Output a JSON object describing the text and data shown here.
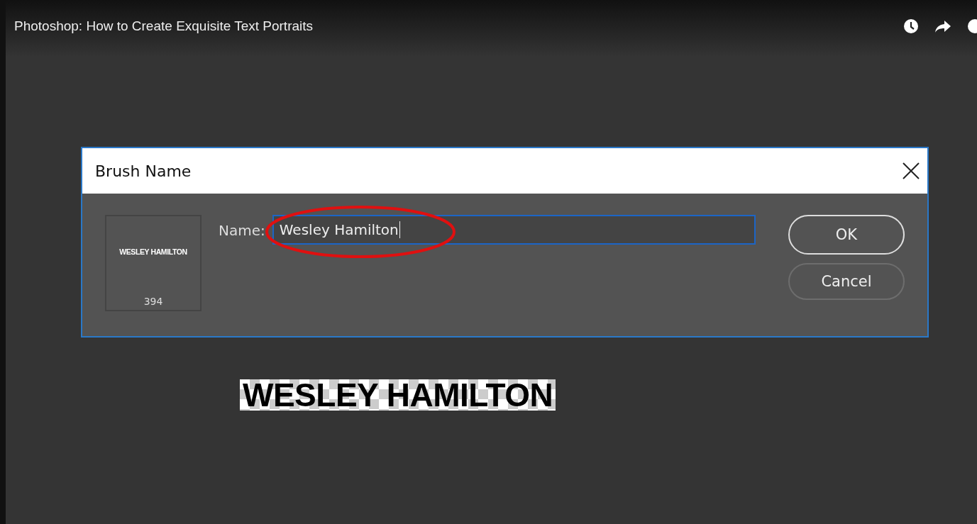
{
  "video": {
    "title": "Photoshop: How to Create Exquisite Text Portraits"
  },
  "dialog": {
    "title": "Brush Name",
    "preview": {
      "label": "WESLEY HAMILTON",
      "size": "394"
    },
    "name_field": {
      "label": "Name:",
      "value": "Wesley Hamilton"
    },
    "buttons": [
      {
        "label": "OK",
        "kind": "primary"
      },
      {
        "label": "Cancel",
        "kind": "secondary"
      }
    ]
  },
  "canvas": {
    "text": "WESLEY HAMILTON"
  }
}
